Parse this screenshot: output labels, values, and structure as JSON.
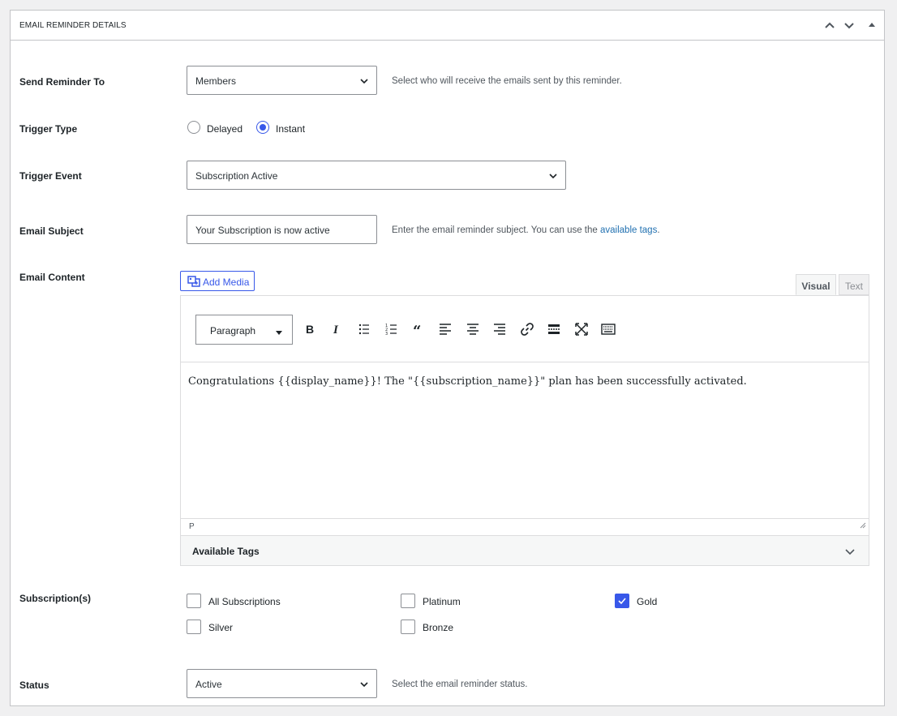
{
  "panel": {
    "title": "EMAIL REMINDER DETAILS"
  },
  "send_to": {
    "label": "Send Reminder To",
    "value": "Members",
    "description": "Select who will receive the emails sent by this reminder."
  },
  "trigger_type": {
    "label": "Trigger Type",
    "options": [
      {
        "label": "Delayed",
        "checked": false
      },
      {
        "label": "Instant",
        "checked": true
      }
    ]
  },
  "trigger_event": {
    "label": "Trigger Event",
    "value": "Subscription Active"
  },
  "email_subject": {
    "label": "Email Subject",
    "value": "Your Subscription is now active",
    "description": "Enter the email reminder subject. You can use the ",
    "link": "available tags",
    "description_end": "."
  },
  "email_content": {
    "label": "Email Content",
    "add_media": "Add Media",
    "tabs": {
      "visual": "Visual",
      "text": "Text"
    },
    "format": "Paragraph",
    "body": "Congratulations {{display_name}}! The \"{{subscription_name}}\" plan has been successfully activated.",
    "path": "P",
    "available_tags": "Available Tags"
  },
  "subscriptions": {
    "label": "Subscription(s)",
    "items": [
      {
        "label": "All Subscriptions",
        "checked": false
      },
      {
        "label": "Platinum",
        "checked": false
      },
      {
        "label": "Gold",
        "checked": true
      },
      {
        "label": "Silver",
        "checked": false
      },
      {
        "label": "Bronze",
        "checked": false
      }
    ]
  },
  "status": {
    "label": "Status",
    "value": "Active",
    "description": "Select the email reminder status."
  },
  "colors": {
    "accent": "#3858e9",
    "link": "#2271b1",
    "border": "#8c8f94"
  }
}
